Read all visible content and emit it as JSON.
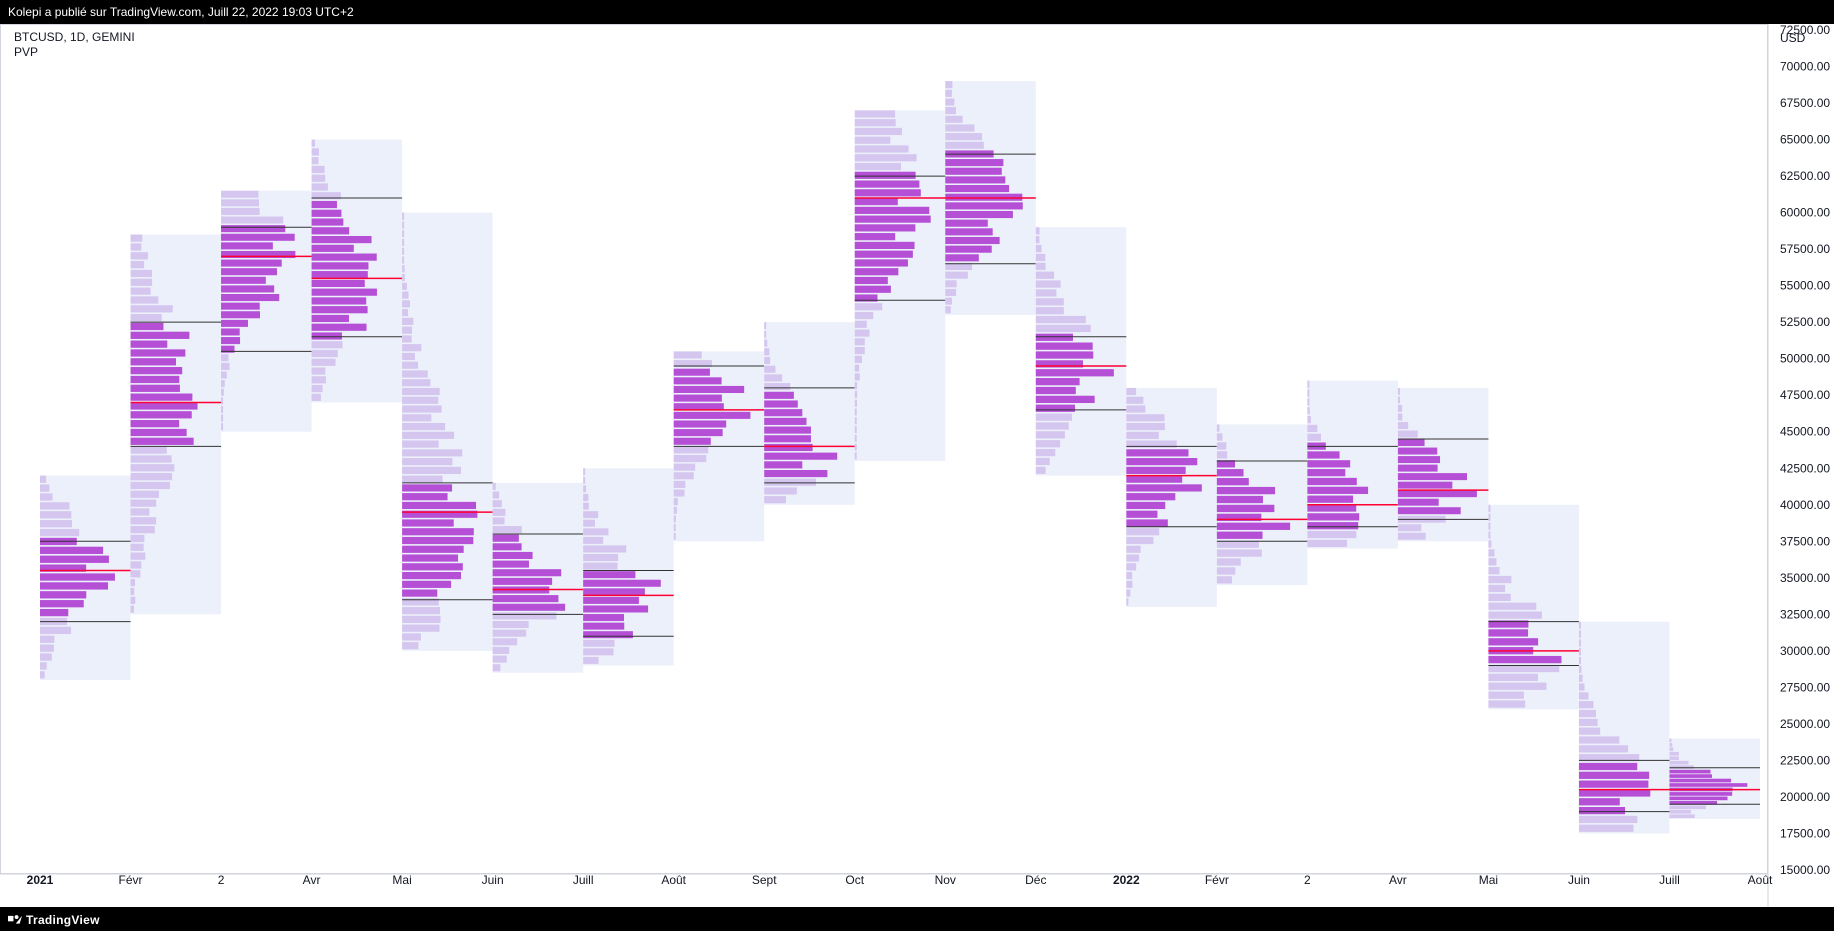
{
  "header": {
    "publish_text": "Kolepi a publié sur TradingView.com, Juill 22, 2022 19:03 UTC+2"
  },
  "legend": {
    "symbol_line": "BTCUSD, 1D, GEMINI",
    "indicator_line": "PVP"
  },
  "footer": {
    "brand": "TradingView"
  },
  "chart_data": {
    "type": "volume-profile-periodic",
    "title": "",
    "xlabel": "",
    "ylabel": "USD",
    "ylim": [
      15000,
      72500
    ],
    "y_ticks": [
      15000,
      17500,
      20000,
      22500,
      25000,
      27500,
      30000,
      32500,
      35000,
      37500,
      40000,
      42500,
      45000,
      47500,
      50000,
      52500,
      55000,
      57500,
      60000,
      62500,
      65000,
      67500,
      70000,
      72500
    ],
    "y_tick_labels": [
      "15000.00",
      "17500.00",
      "20000.00",
      "22500.00",
      "25000.00",
      "27500.00",
      "30000.00",
      "32500.00",
      "35000.00",
      "37500.00",
      "40000.00",
      "42500.00",
      "45000.00",
      "47500.00",
      "50000.00",
      "52500.00",
      "55000.00",
      "57500.00",
      "60000.00",
      "62500.00",
      "65000.00",
      "67500.00",
      "70000.00",
      "72500.00"
    ],
    "x_tick_labels": [
      "2021",
      "Févr",
      "2",
      "Avr",
      "Mai",
      "Juin",
      "Juill",
      "Août",
      "Sept",
      "Oct",
      "Nov",
      "Déc",
      "2022",
      "Févr",
      "2",
      "Avr",
      "Mai",
      "Juin",
      "Juill",
      "Août"
    ],
    "x_tick_bold": [
      true,
      false,
      false,
      false,
      false,
      false,
      false,
      false,
      false,
      false,
      false,
      false,
      true,
      false,
      false,
      false,
      false,
      false,
      false,
      false
    ],
    "periods": [
      {
        "label": "2021-01",
        "low": 28000,
        "high": 42000,
        "va_low": 32000,
        "va_high": 37500,
        "poc": 35500
      },
      {
        "label": "2021-02",
        "low": 32500,
        "high": 58500,
        "va_low": 44000,
        "va_high": 52500,
        "poc": 47000
      },
      {
        "label": "2021-03",
        "low": 45000,
        "high": 61500,
        "va_low": 50500,
        "va_high": 59000,
        "poc": 57000
      },
      {
        "label": "2021-04",
        "low": 47000,
        "high": 65000,
        "va_low": 51500,
        "va_high": 61000,
        "poc": 55500
      },
      {
        "label": "2021-05",
        "low": 30000,
        "high": 60000,
        "va_low": 33500,
        "va_high": 41500,
        "poc": 39500
      },
      {
        "label": "2021-06",
        "low": 28500,
        "high": 41500,
        "va_low": 32500,
        "va_high": 38000,
        "poc": 34200
      },
      {
        "label": "2021-07",
        "low": 29000,
        "high": 42500,
        "va_low": 31000,
        "va_high": 35500,
        "poc": 33800
      },
      {
        "label": "2021-08",
        "low": 37500,
        "high": 50500,
        "va_low": 44000,
        "va_high": 49500,
        "poc": 46500
      },
      {
        "label": "2021-09",
        "low": 40000,
        "high": 52500,
        "va_low": 41500,
        "va_high": 48000,
        "poc": 44000
      },
      {
        "label": "2021-10",
        "low": 43000,
        "high": 67000,
        "va_low": 54000,
        "va_high": 62500,
        "poc": 61000
      },
      {
        "label": "2021-11",
        "low": 53000,
        "high": 69000,
        "va_low": 56500,
        "va_high": 64000,
        "poc": 61000
      },
      {
        "label": "2021-12",
        "low": 42000,
        "high": 59000,
        "va_low": 46500,
        "va_high": 51500,
        "poc": 49500
      },
      {
        "label": "2022-01",
        "low": 33000,
        "high": 48000,
        "va_low": 38500,
        "va_high": 44000,
        "poc": 42000
      },
      {
        "label": "2022-02",
        "low": 34500,
        "high": 45500,
        "va_low": 37500,
        "va_high": 43000,
        "poc": 39000
      },
      {
        "label": "2022-03",
        "low": 37000,
        "high": 48500,
        "va_low": 38500,
        "va_high": 44000,
        "poc": 40000
      },
      {
        "label": "2022-04",
        "low": 37500,
        "high": 48000,
        "va_low": 39000,
        "va_high": 44500,
        "poc": 41000
      },
      {
        "label": "2022-05",
        "low": 26000,
        "high": 40000,
        "va_low": 29000,
        "va_high": 32000,
        "poc": 30000
      },
      {
        "label": "2022-06",
        "low": 17500,
        "high": 32000,
        "va_low": 19000,
        "va_high": 22500,
        "poc": 20500
      },
      {
        "label": "2022-07",
        "low": 18500,
        "high": 24000,
        "va_low": 19500,
        "va_high": 22000,
        "poc": 20500
      }
    ]
  }
}
